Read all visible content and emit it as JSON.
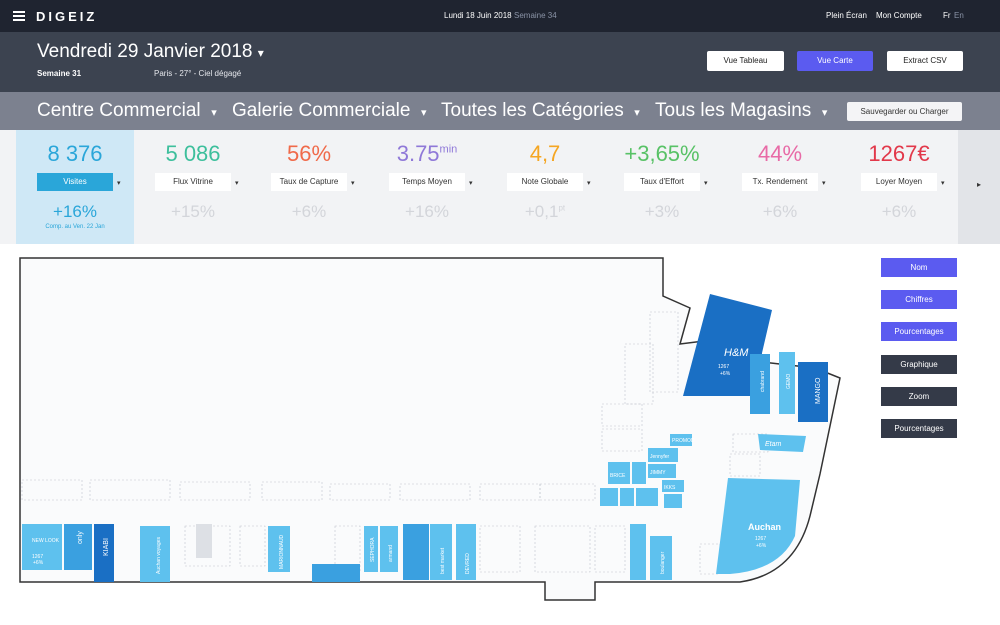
{
  "app": {
    "logo": "DIGEIZ",
    "date": "Lundi 18 Juin 2018",
    "week": "Semaine 34"
  },
  "topnav": {
    "fullscreen": "Plein Écran",
    "account": "Mon Compte",
    "lang_fr": "Fr",
    "lang_en": "En"
  },
  "header": {
    "date": "Vendredi 29 Janvier 2018",
    "date_caret": "▾",
    "week": "Semaine 31",
    "weather": "Paris - 27° - Ciel dégagé",
    "btn_table": "Vue Tableau",
    "btn_map": "Vue Carte",
    "btn_csv": "Extract CSV"
  },
  "filters": {
    "center": "Centre Commercial",
    "gallery": "Galerie Commerciale",
    "categories": "Toutes les Catégories",
    "stores": "Tous les Magasins",
    "caret": "▾",
    "save": "Sauvegarder ou Charger"
  },
  "kpis": [
    {
      "value": "8 376",
      "unit": "",
      "label": "Visites",
      "change": "+16%",
      "change_unit": "",
      "comp": "Comp. au Ven. 22 Jan",
      "color": "#2aa6d9"
    },
    {
      "value": "5 086",
      "unit": "",
      "label": "Flux Vitrine",
      "change": "+15%",
      "change_unit": "",
      "color": "#3dbf9c"
    },
    {
      "value": "56%",
      "unit": "",
      "label": "Taux de Capture",
      "change": "+6%",
      "change_unit": "",
      "color": "#f06a4a"
    },
    {
      "value": "3.75",
      "unit": "min",
      "label": "Temps Moyen",
      "change": "+16%",
      "change_unit": "",
      "color": "#8f78d8"
    },
    {
      "value": "4,7",
      "unit": "",
      "label": "Note Globale",
      "change": "+0,1",
      "change_unit": "pt",
      "color": "#f5a623"
    },
    {
      "value": "+3,65%",
      "unit": "",
      "label": "Taux d'Effort",
      "change": "+3%",
      "change_unit": "",
      "color": "#58c266"
    },
    {
      "value": "44%",
      "unit": "",
      "label": "Tx. Rendement",
      "change": "+6%",
      "change_unit": "",
      "color": "#e86aa6"
    },
    {
      "value": "1267€",
      "unit": "",
      "label": "Loyer Moyen",
      "change": "+6%",
      "change_unit": "",
      "color": "#e2384a"
    }
  ],
  "kpi_next": "▸",
  "side_buttons": [
    {
      "label": "Nom",
      "style": "blue"
    },
    {
      "label": "Chiffres",
      "style": "blue"
    },
    {
      "label": "Pourcentages",
      "style": "blue"
    },
    {
      "label": "Graphique",
      "style": "dark"
    },
    {
      "label": "Zoom",
      "style": "dark"
    },
    {
      "label": "Pourcentages",
      "style": "dark"
    }
  ],
  "map": {
    "store_value": "1267",
    "store_change": "+6%",
    "stores": {
      "hm": "H&M",
      "chabrand": "chabrand",
      "gemo": "GEMO",
      "mango": "MANGO",
      "etam": "Etam",
      "auchan": "Auchan",
      "brice": "BRICE",
      "jennyfer": "Jennyfer",
      "promod": "PROMOD",
      "jimmy": "JIMMY",
      "ikks": "IKKS",
      "newlook": "NEW LOOK",
      "only": "only",
      "kiabi": "KIABI",
      "auchan_voyages": "Auchan voyages",
      "marionnaud": "MARIONNAUD",
      "sephora": "SEPHORA",
      "armand": "armand",
      "boulanger": "boulanger",
      "bestmarket": "best market",
      "devred": "DEVRED"
    }
  }
}
